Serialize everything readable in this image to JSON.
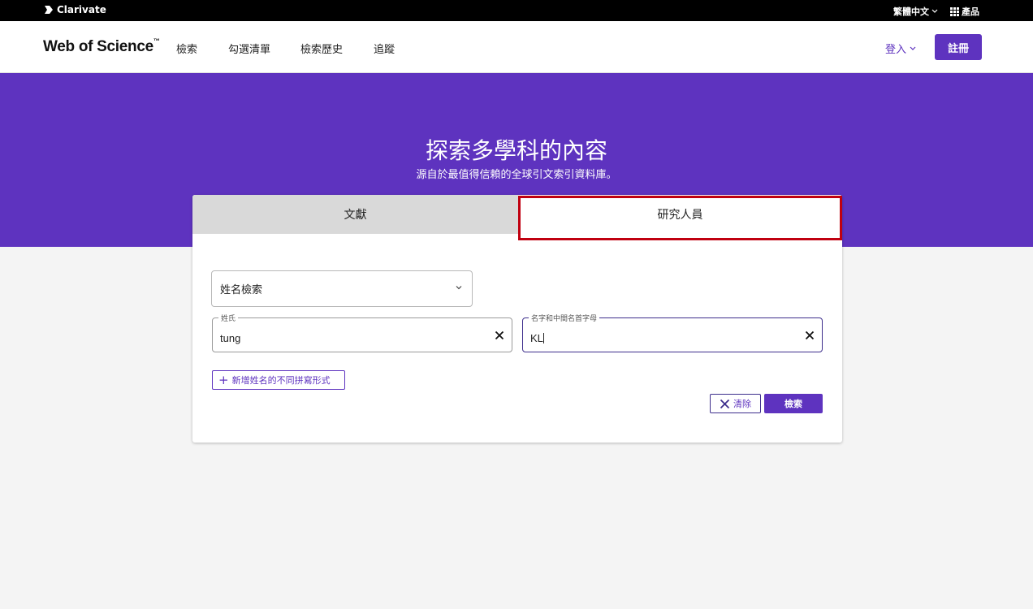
{
  "topbar": {
    "brand": "Clarivate",
    "language": "繁體中文",
    "products": "產品"
  },
  "header": {
    "logo": "Web of Science",
    "logo_tm": "™",
    "nav": [
      "檢索",
      "勾選清單",
      "檢索歷史",
      "追蹤"
    ],
    "login": "登入",
    "register": "註冊"
  },
  "hero": {
    "title": "探索多學科的內容",
    "subtitle": "源自於最值得信賴的全球引文索引資料庫。"
  },
  "tabs": {
    "documents": "文獻",
    "researchers": "研究人員"
  },
  "form": {
    "search_type": "姓名檢索",
    "last_name_label": "姓氏",
    "last_name_value": "tung",
    "first_name_label": "名字和中間名首字母",
    "first_name_value": "KL",
    "add_variant": "新增姓名的不同拼寫形式",
    "clear": "清除",
    "search": "檢索"
  },
  "colors": {
    "brand_purple": "#5e33bf",
    "highlight_red": "#c00010"
  }
}
